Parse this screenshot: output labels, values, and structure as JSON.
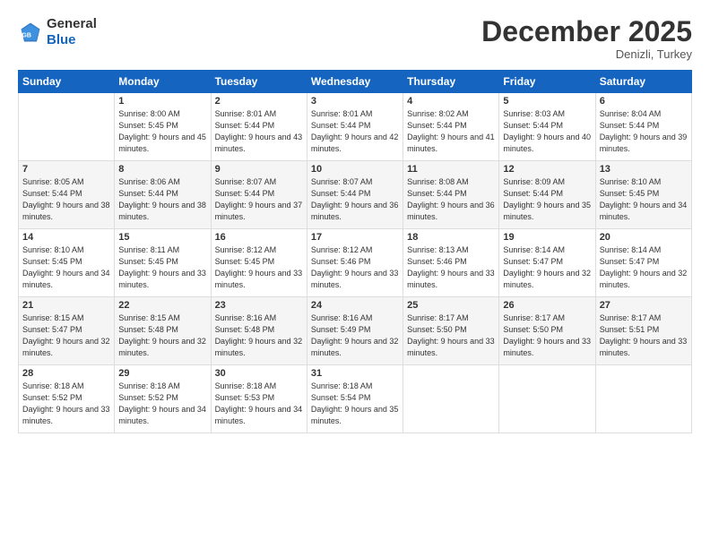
{
  "logo": {
    "general": "General",
    "blue": "Blue"
  },
  "header": {
    "title": "December 2025",
    "location": "Denizli, Turkey"
  },
  "days_of_week": [
    "Sunday",
    "Monday",
    "Tuesday",
    "Wednesday",
    "Thursday",
    "Friday",
    "Saturday"
  ],
  "weeks": [
    [
      {
        "day": "",
        "sunrise": "",
        "sunset": "",
        "daylight": ""
      },
      {
        "day": "1",
        "sunrise": "Sunrise: 8:00 AM",
        "sunset": "Sunset: 5:45 PM",
        "daylight": "Daylight: 9 hours and 45 minutes."
      },
      {
        "day": "2",
        "sunrise": "Sunrise: 8:01 AM",
        "sunset": "Sunset: 5:44 PM",
        "daylight": "Daylight: 9 hours and 43 minutes."
      },
      {
        "day": "3",
        "sunrise": "Sunrise: 8:01 AM",
        "sunset": "Sunset: 5:44 PM",
        "daylight": "Daylight: 9 hours and 42 minutes."
      },
      {
        "day": "4",
        "sunrise": "Sunrise: 8:02 AM",
        "sunset": "Sunset: 5:44 PM",
        "daylight": "Daylight: 9 hours and 41 minutes."
      },
      {
        "day": "5",
        "sunrise": "Sunrise: 8:03 AM",
        "sunset": "Sunset: 5:44 PM",
        "daylight": "Daylight: 9 hours and 40 minutes."
      },
      {
        "day": "6",
        "sunrise": "Sunrise: 8:04 AM",
        "sunset": "Sunset: 5:44 PM",
        "daylight": "Daylight: 9 hours and 39 minutes."
      }
    ],
    [
      {
        "day": "7",
        "sunrise": "Sunrise: 8:05 AM",
        "sunset": "Sunset: 5:44 PM",
        "daylight": "Daylight: 9 hours and 38 minutes."
      },
      {
        "day": "8",
        "sunrise": "Sunrise: 8:06 AM",
        "sunset": "Sunset: 5:44 PM",
        "daylight": "Daylight: 9 hours and 38 minutes."
      },
      {
        "day": "9",
        "sunrise": "Sunrise: 8:07 AM",
        "sunset": "Sunset: 5:44 PM",
        "daylight": "Daylight: 9 hours and 37 minutes."
      },
      {
        "day": "10",
        "sunrise": "Sunrise: 8:07 AM",
        "sunset": "Sunset: 5:44 PM",
        "daylight": "Daylight: 9 hours and 36 minutes."
      },
      {
        "day": "11",
        "sunrise": "Sunrise: 8:08 AM",
        "sunset": "Sunset: 5:44 PM",
        "daylight": "Daylight: 9 hours and 36 minutes."
      },
      {
        "day": "12",
        "sunrise": "Sunrise: 8:09 AM",
        "sunset": "Sunset: 5:44 PM",
        "daylight": "Daylight: 9 hours and 35 minutes."
      },
      {
        "day": "13",
        "sunrise": "Sunrise: 8:10 AM",
        "sunset": "Sunset: 5:45 PM",
        "daylight": "Daylight: 9 hours and 34 minutes."
      }
    ],
    [
      {
        "day": "14",
        "sunrise": "Sunrise: 8:10 AM",
        "sunset": "Sunset: 5:45 PM",
        "daylight": "Daylight: 9 hours and 34 minutes."
      },
      {
        "day": "15",
        "sunrise": "Sunrise: 8:11 AM",
        "sunset": "Sunset: 5:45 PM",
        "daylight": "Daylight: 9 hours and 33 minutes."
      },
      {
        "day": "16",
        "sunrise": "Sunrise: 8:12 AM",
        "sunset": "Sunset: 5:45 PM",
        "daylight": "Daylight: 9 hours and 33 minutes."
      },
      {
        "day": "17",
        "sunrise": "Sunrise: 8:12 AM",
        "sunset": "Sunset: 5:46 PM",
        "daylight": "Daylight: 9 hours and 33 minutes."
      },
      {
        "day": "18",
        "sunrise": "Sunrise: 8:13 AM",
        "sunset": "Sunset: 5:46 PM",
        "daylight": "Daylight: 9 hours and 33 minutes."
      },
      {
        "day": "19",
        "sunrise": "Sunrise: 8:14 AM",
        "sunset": "Sunset: 5:47 PM",
        "daylight": "Daylight: 9 hours and 32 minutes."
      },
      {
        "day": "20",
        "sunrise": "Sunrise: 8:14 AM",
        "sunset": "Sunset: 5:47 PM",
        "daylight": "Daylight: 9 hours and 32 minutes."
      }
    ],
    [
      {
        "day": "21",
        "sunrise": "Sunrise: 8:15 AM",
        "sunset": "Sunset: 5:47 PM",
        "daylight": "Daylight: 9 hours and 32 minutes."
      },
      {
        "day": "22",
        "sunrise": "Sunrise: 8:15 AM",
        "sunset": "Sunset: 5:48 PM",
        "daylight": "Daylight: 9 hours and 32 minutes."
      },
      {
        "day": "23",
        "sunrise": "Sunrise: 8:16 AM",
        "sunset": "Sunset: 5:48 PM",
        "daylight": "Daylight: 9 hours and 32 minutes."
      },
      {
        "day": "24",
        "sunrise": "Sunrise: 8:16 AM",
        "sunset": "Sunset: 5:49 PM",
        "daylight": "Daylight: 9 hours and 32 minutes."
      },
      {
        "day": "25",
        "sunrise": "Sunrise: 8:17 AM",
        "sunset": "Sunset: 5:50 PM",
        "daylight": "Daylight: 9 hours and 33 minutes."
      },
      {
        "day": "26",
        "sunrise": "Sunrise: 8:17 AM",
        "sunset": "Sunset: 5:50 PM",
        "daylight": "Daylight: 9 hours and 33 minutes."
      },
      {
        "day": "27",
        "sunrise": "Sunrise: 8:17 AM",
        "sunset": "Sunset: 5:51 PM",
        "daylight": "Daylight: 9 hours and 33 minutes."
      }
    ],
    [
      {
        "day": "28",
        "sunrise": "Sunrise: 8:18 AM",
        "sunset": "Sunset: 5:52 PM",
        "daylight": "Daylight: 9 hours and 33 minutes."
      },
      {
        "day": "29",
        "sunrise": "Sunrise: 8:18 AM",
        "sunset": "Sunset: 5:52 PM",
        "daylight": "Daylight: 9 hours and 34 minutes."
      },
      {
        "day": "30",
        "sunrise": "Sunrise: 8:18 AM",
        "sunset": "Sunset: 5:53 PM",
        "daylight": "Daylight: 9 hours and 34 minutes."
      },
      {
        "day": "31",
        "sunrise": "Sunrise: 8:18 AM",
        "sunset": "Sunset: 5:54 PM",
        "daylight": "Daylight: 9 hours and 35 minutes."
      },
      {
        "day": "",
        "sunrise": "",
        "sunset": "",
        "daylight": ""
      },
      {
        "day": "",
        "sunrise": "",
        "sunset": "",
        "daylight": ""
      },
      {
        "day": "",
        "sunrise": "",
        "sunset": "",
        "daylight": ""
      }
    ]
  ]
}
